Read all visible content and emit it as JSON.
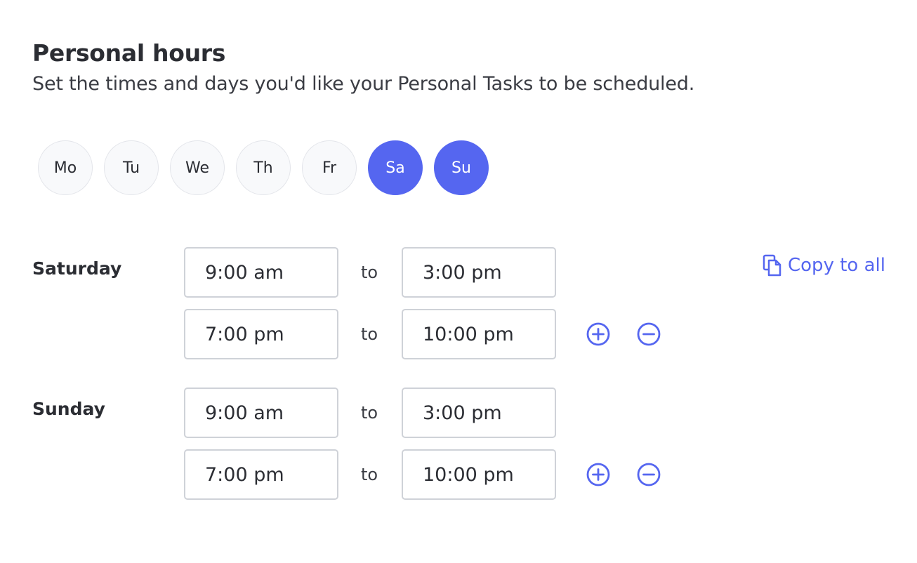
{
  "header": {
    "title": "Personal hours",
    "subtitle": "Set the times and days you'd like your Personal Tasks to be scheduled."
  },
  "days": [
    {
      "label": "Mo",
      "selected": false
    },
    {
      "label": "Tu",
      "selected": false
    },
    {
      "label": "We",
      "selected": false
    },
    {
      "label": "Th",
      "selected": false
    },
    {
      "label": "Fr",
      "selected": false
    },
    {
      "label": "Sa",
      "selected": true
    },
    {
      "label": "Su",
      "selected": true
    }
  ],
  "schedule": {
    "saturday": {
      "label": "Saturday",
      "ranges": [
        {
          "start": "9:00 am",
          "to": "to",
          "end": "3:00 pm"
        },
        {
          "start": "7:00 pm",
          "to": "to",
          "end": "10:00 pm"
        }
      ]
    },
    "sunday": {
      "label": "Sunday",
      "ranges": [
        {
          "start": "9:00 am",
          "to": "to",
          "end": "3:00 pm"
        },
        {
          "start": "7:00 pm",
          "to": "to",
          "end": "10:00 pm"
        }
      ]
    }
  },
  "actions": {
    "copy_to_all": "Copy to all"
  },
  "icons": {
    "copy": "copy-icon",
    "add": "plus-circle-icon",
    "remove": "minus-circle-icon"
  },
  "colors": {
    "accent": "#5566f0",
    "text": "#2b2d33",
    "border": "#cfd2d8",
    "day_bg": "#f8f9fb"
  }
}
